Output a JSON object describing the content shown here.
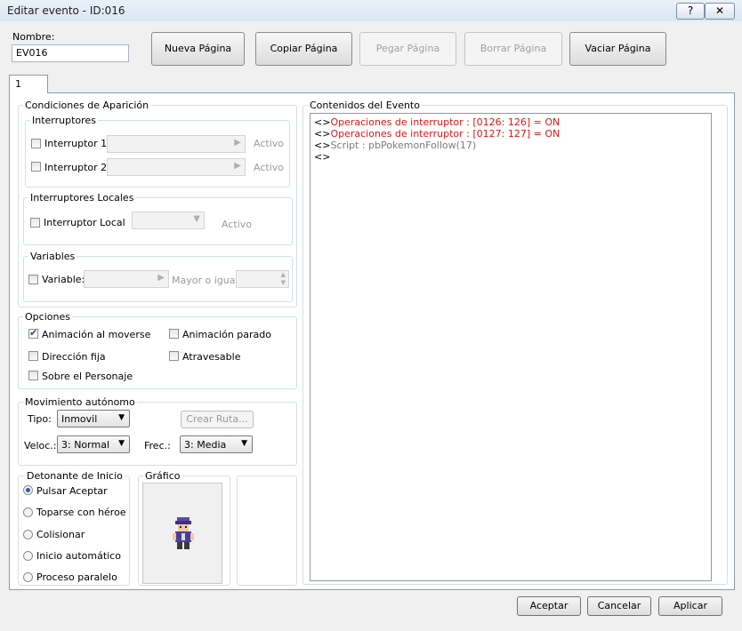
{
  "window": {
    "title": "Editar evento - ID:016",
    "help_label": "?",
    "close_label": "✕"
  },
  "name": {
    "label": "Nombre:",
    "value": "EV016"
  },
  "page_buttons": {
    "new": "Nueva Página",
    "copy": "Copiar Página",
    "paste": "Pegar Página",
    "delete": "Borrar Página",
    "clear": "Vaciar Página"
  },
  "tab": {
    "label": "1"
  },
  "conditions": {
    "title": "Condiciones de Aparición",
    "switches_title": "Interruptores",
    "switch1_label": "Interruptor 1",
    "switch2_label": "Interruptor 2",
    "active1": "Activo",
    "active2": "Activo",
    "local_title": "Interruptores Locales",
    "local_label": "Interruptor Local",
    "local_active": "Activo",
    "variables_title": "Variables",
    "variable_label": "Variable:",
    "greater_equal": "Mayor o igual"
  },
  "options": {
    "title": "Opciones",
    "move_anim": "Animación al moverse",
    "stop_anim": "Animación parado",
    "fixed_dir": "Dirección fija",
    "through": "Atravesable",
    "above": "Sobre el Personaje"
  },
  "movement": {
    "title": "Movimiento autónomo",
    "type_label": "Tipo:",
    "type_value": "Inmovil",
    "route_button": "Crear Ruta...",
    "speed_label": "Veloc.:",
    "speed_value": "3: Normal",
    "freq_label": "Frec.:",
    "freq_value": "3: Media"
  },
  "trigger": {
    "title": "Detonante de Inicio",
    "options": [
      "Pulsar Aceptar",
      "Toparse con héroe",
      "Colisionar",
      "Inicio automático",
      "Proceso paralelo"
    ]
  },
  "graphic": {
    "title": "Gráfico"
  },
  "contents": {
    "title": "Contenidos del Evento",
    "lines": [
      {
        "prefix": "<>",
        "text": "Operaciones de interruptor : [0126: 126] = ON"
      },
      {
        "prefix": "<>",
        "text": "Operaciones de interruptor : [0127: 127] = ON"
      },
      {
        "prefix": "<>",
        "text": "Script : pbPokemonFollow(17)"
      },
      {
        "prefix": "<>",
        "text": ""
      }
    ]
  },
  "dialog_buttons": {
    "ok": "Aceptar",
    "cancel": "Cancelar",
    "apply": "Aplicar"
  },
  "colors": {
    "command_red": "#e21313",
    "script_gray": "#7a7a7a",
    "sprite_purple": "#5a4aa8"
  }
}
